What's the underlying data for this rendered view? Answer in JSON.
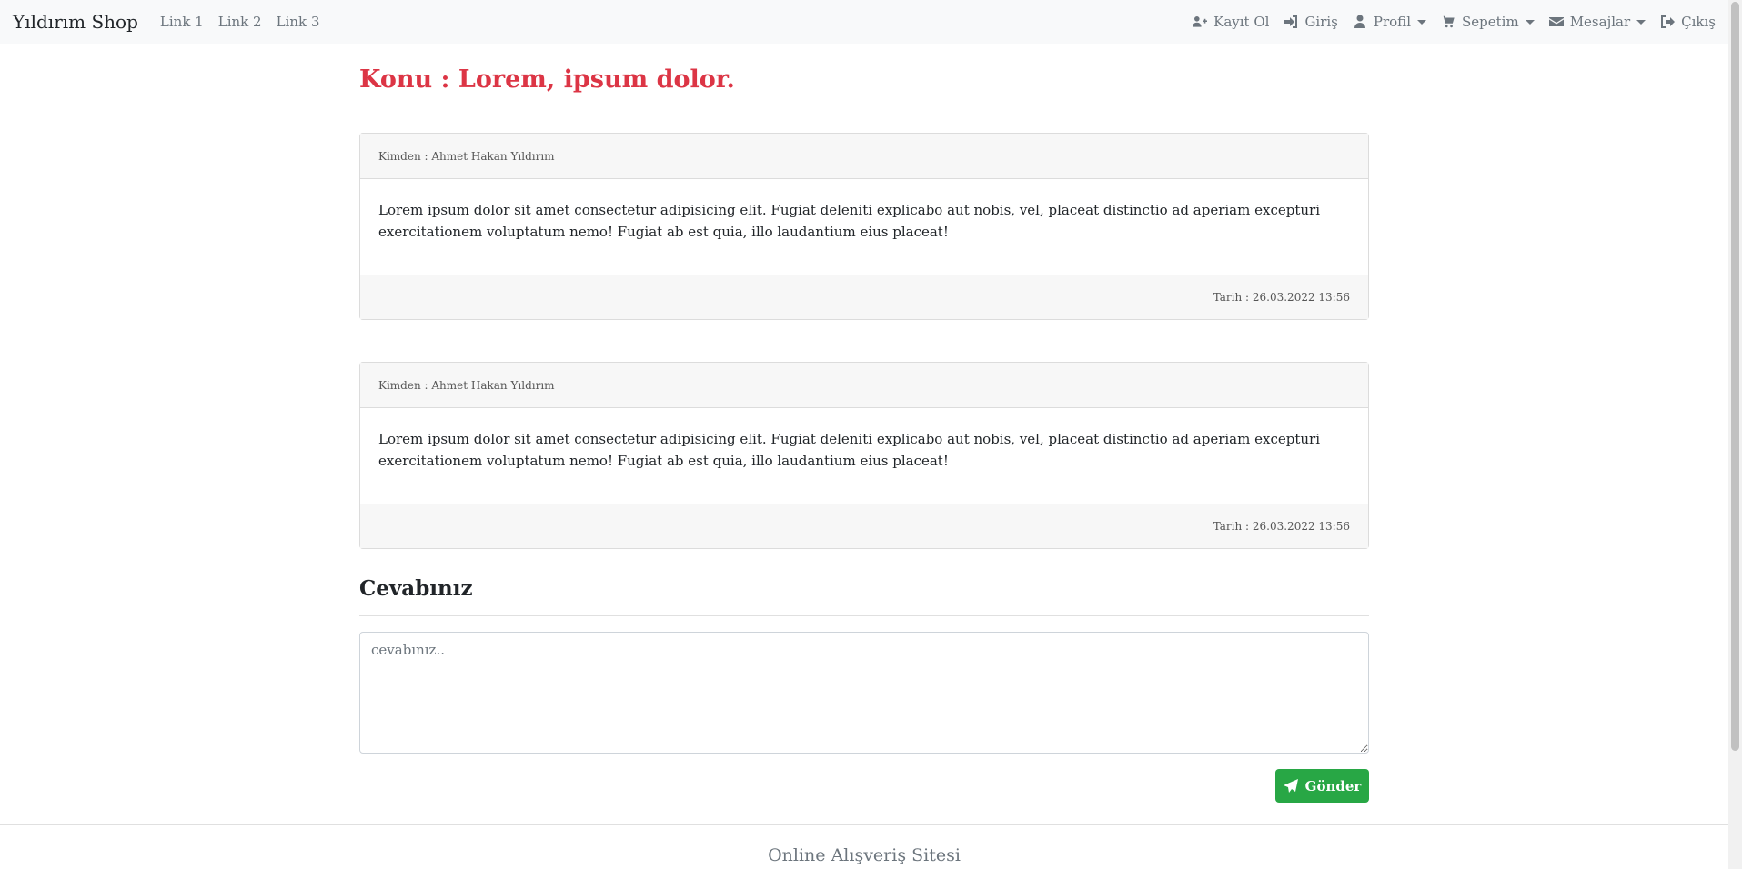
{
  "navbar": {
    "brand": "Yıldırım Shop",
    "links": [
      "Link 1",
      "Link 2",
      "Link 3"
    ],
    "right": {
      "register": "Kayıt Ol",
      "login": "Giriş",
      "profile": "Profil",
      "cart": "Sepetim",
      "messages": "Mesajlar",
      "logout": "Çıkış"
    }
  },
  "subject": "Konu : Lorem, ipsum dolor.",
  "messages": [
    {
      "from": "Kimden : Ahmet Hakan Yıldırım",
      "body": "Lorem ipsum dolor sit amet consectetur adipisicing elit. Fugiat deleniti explicabo aut nobis, vel, placeat distinctio ad aperiam excepturi exercitationem voluptatum nemo! Fugiat ab est quia, illo laudantium eius placeat!",
      "date": "Tarih : 26.03.2022 13:56"
    },
    {
      "from": "Kimden : Ahmet Hakan Yıldırım",
      "body": "Lorem ipsum dolor sit amet consectetur adipisicing elit. Fugiat deleniti explicabo aut nobis, vel, placeat distinctio ad aperiam excepturi exercitationem voluptatum nemo! Fugiat ab est quia, illo laudantium eius placeat!",
      "date": "Tarih : 26.03.2022 13:56"
    }
  ],
  "reply": {
    "title": "Cevabınız",
    "placeholder": "cevabınız..",
    "value": "",
    "send_label": "Gönder"
  },
  "footer": {
    "text": "Online Alışveriş Sitesi"
  },
  "colors": {
    "accent_red": "#dc3545",
    "button_green": "#28a745",
    "navbar_bg": "#f8f9fa"
  },
  "icons": {
    "register": "user-plus-icon",
    "login": "sign-in-icon",
    "profile": "user-icon",
    "cart": "cart-icon",
    "messages": "envelope-icon",
    "logout": "sign-out-icon",
    "send": "paper-plane-icon"
  }
}
